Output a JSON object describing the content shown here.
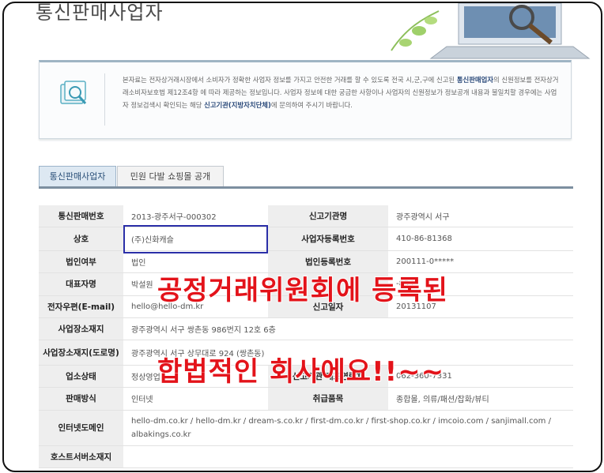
{
  "page": {
    "title": "통신판매사업자"
  },
  "notice": {
    "part1": "본자료는 전자상거래시장에서 소비자가 정확한 사업자 정보를 가지고 안전한 거래를 할 수 있도록 전국 시,군,구에 신고된 ",
    "bold1": "통신판매업자",
    "part2": "의 신원정보를 전자상거래소비자보호법 제12조4항 에 따라 제공하는 정보입니다. 사업자 정보에 대한 궁금한 사항이나 사업자의 신원정보가 정보공개 내용과 불일치할 경우에는 사업자 정보검색시 확인되는 해당 ",
    "bold2": "신고기관(지방자치단체)",
    "part3": "에 문의하여 주시기 바랍니다."
  },
  "tabs": [
    {
      "label": "통신판매사업자",
      "active": true
    },
    {
      "label": "민원 다발 쇼핑몰 공개",
      "active": false
    }
  ],
  "table": {
    "rows": [
      [
        "통신판매번호",
        "2013-광주서구-000302",
        "신고기관명",
        "광주광역시 서구"
      ],
      [
        "상호",
        "(주)신화캐슬",
        "사업자등록번호",
        "410-86-81368"
      ],
      [
        "법인여부",
        "법인",
        "법인등록번호",
        "200111-0*****"
      ],
      [
        "대표자명",
        "박설원",
        "",
        "-854"
      ],
      [
        "전자우편(E-mail)",
        "hello@hello-dm.kr",
        "신고일자",
        "20131107"
      ],
      [
        "사업장소재지",
        "광주광역시 서구 쌍촌동 986번지 12호 6층"
      ],
      [
        "사업장소재지(도로명)",
        "광주광역시 서구 상무대로 924 (쌍촌동)"
      ],
      [
        "업소상태",
        "정상영업",
        "신고기관 대표연락처",
        "062-360-7331"
      ],
      [
        "판매방식",
        "인터넷",
        "취급품목",
        "종합몰, 의류/패션/잡화/뷰티"
      ],
      [
        "인터넷도메인",
        "hello-dm.co.kr / hello-dm.kr / dream-s.co.kr / first-dm.co.kr / first-shop.co.kr / imcoio.com / sanjimall.com / albakings.co.kr"
      ],
      [
        "호스트서버소재지",
        ""
      ]
    ]
  },
  "overlay": {
    "line1": "공정거래위원회에 등록된",
    "line2": "합법적인 회사에요!!~~"
  },
  "colors": {
    "overlay_text": "#e3131a",
    "highlight_border": "#2b2fa8",
    "tab_active": "#dde8f2"
  }
}
